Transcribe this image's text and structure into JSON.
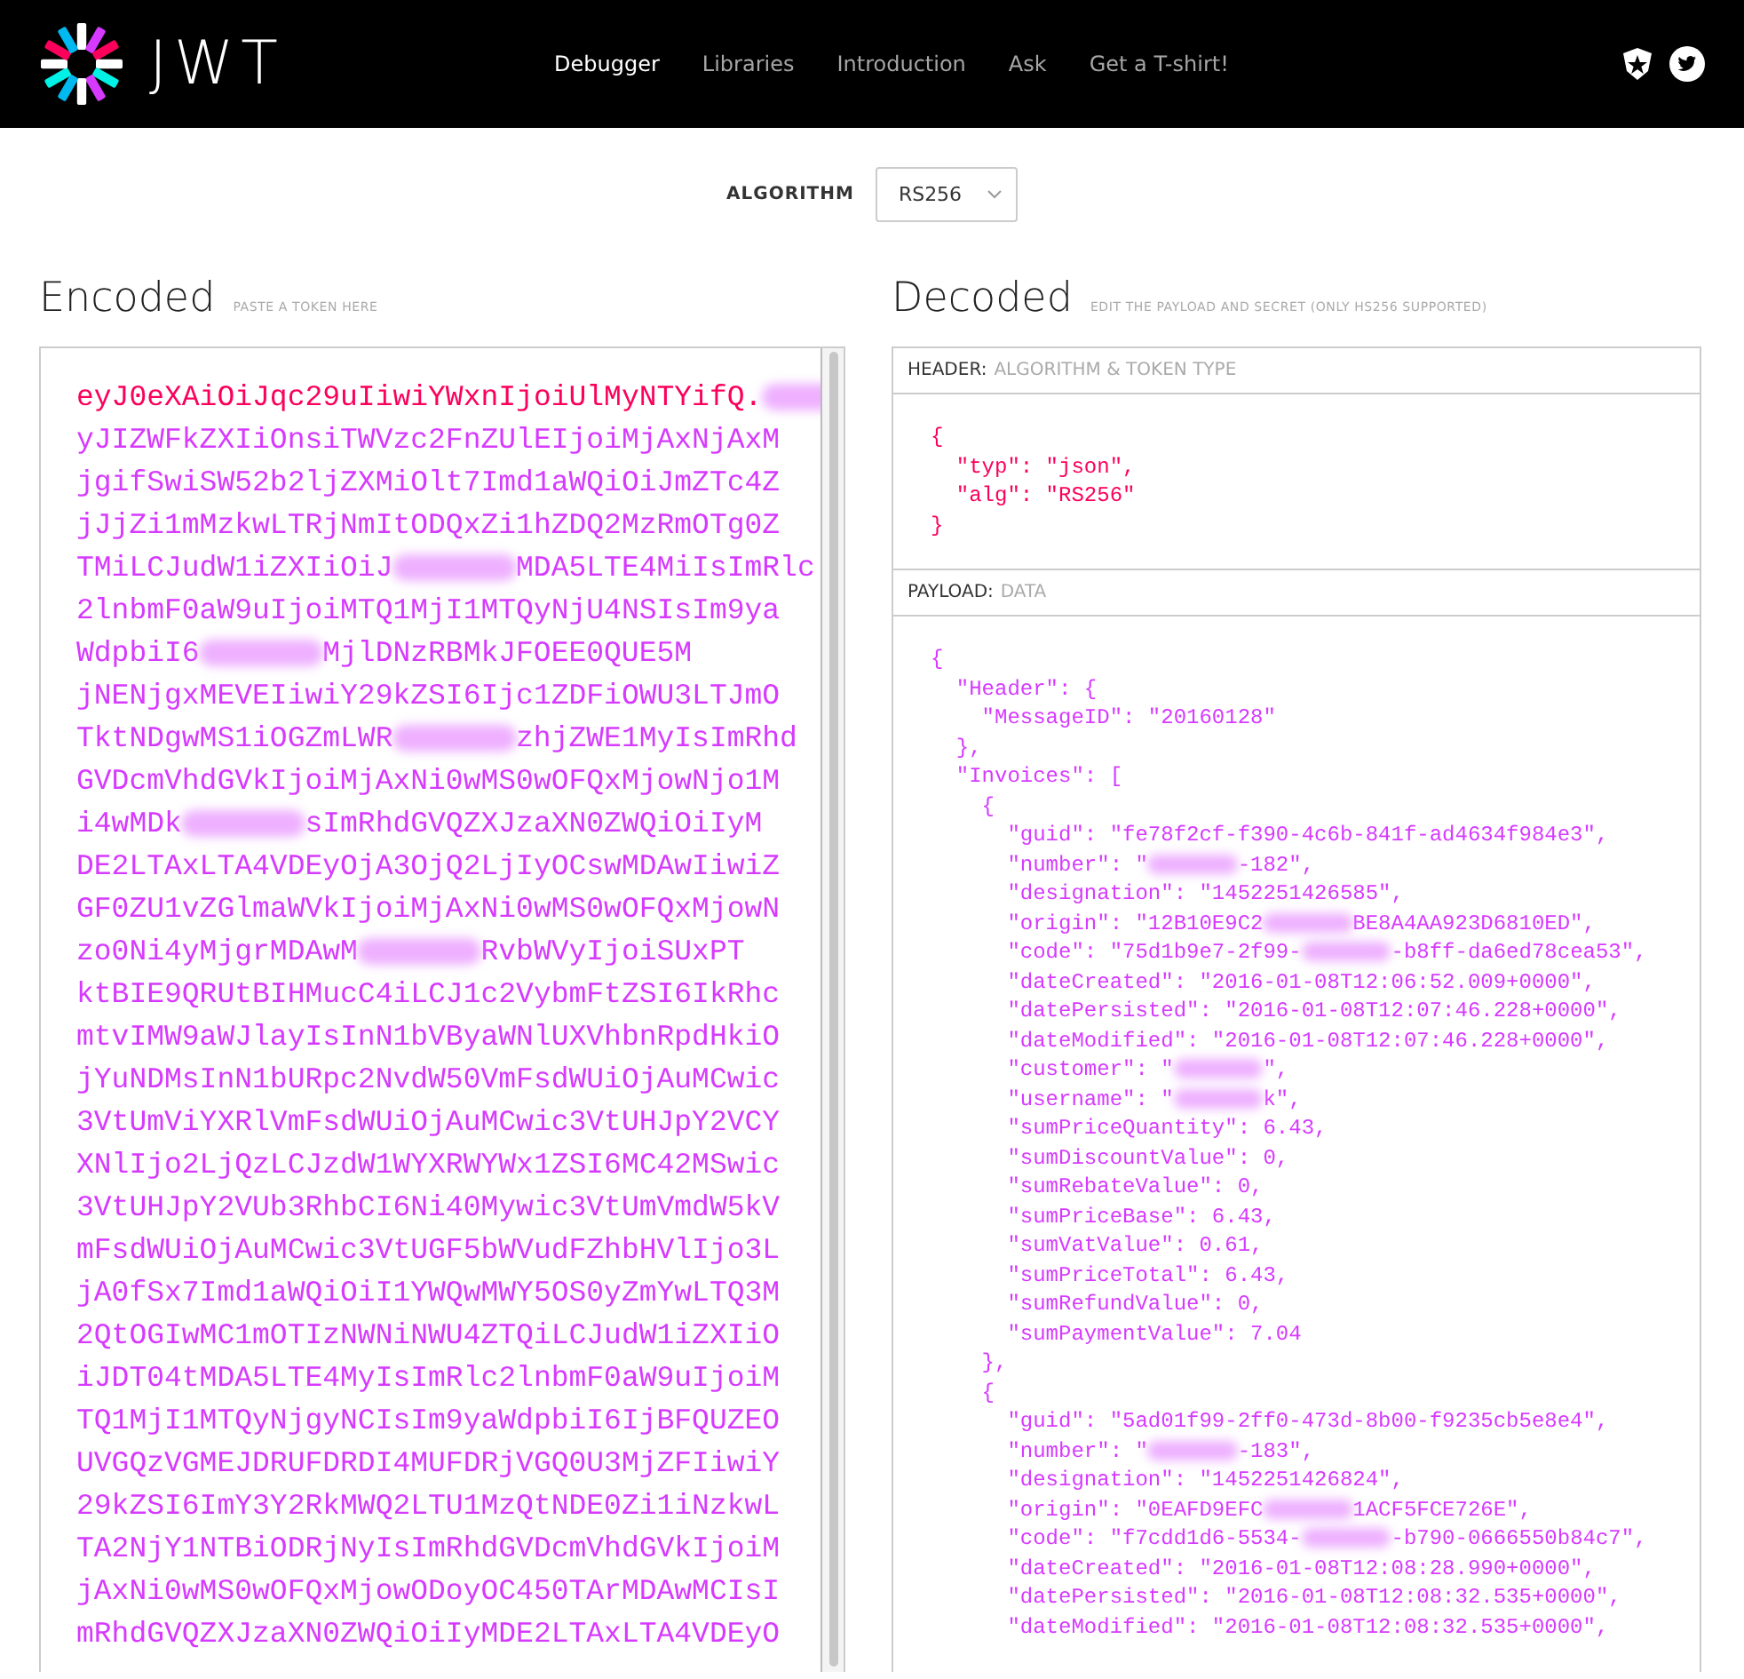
{
  "nav": {
    "brand": "JWT",
    "links": [
      {
        "label": "Debugger",
        "selected": true
      },
      {
        "label": "Libraries",
        "selected": false
      },
      {
        "label": "Introduction",
        "selected": false
      },
      {
        "label": "Ask",
        "selected": false
      },
      {
        "label": "Get a T-shirt!",
        "selected": false
      }
    ]
  },
  "algorithm": {
    "label": "ALGORITHM",
    "value": "RS256"
  },
  "encoded": {
    "title": "Encoded",
    "hint": "PASTE A TOKEN HERE",
    "header_lines": [
      {
        "parts": [
          "eyJ0eXAiOiJqc29uIiwiYWxnIjoiUlMyNTYifQ.",
          {
            "kind": "blur"
          }
        ]
      }
    ],
    "payload_lines": [
      {
        "parts": [
          "yJIZWFkZXIiOnsiTWVzc2FnZUlEIjoiMjAxNjAxM"
        ]
      },
      {
        "parts": [
          "jgifSwiSW52b2ljZXMiOlt7Imd1aWQiOiJmZTc4Z"
        ]
      },
      {
        "parts": [
          "jJjZi1mMzkwLTRjNmItODQxZi1hZDQ2MzRmOTg0Z"
        ]
      },
      {
        "parts": [
          "TMiLCJudW1iZXIiOiJ",
          {
            "kind": "blur"
          },
          "MDA5LTE4MiIsImRlc"
        ]
      },
      {
        "parts": [
          "2lnbmF0aW9uIjoiMTQ1MjI1MTQyNjU4NSIsIm9ya"
        ]
      },
      {
        "parts": [
          "WdpbiI6",
          {
            "kind": "blur"
          },
          "MjlDNzRBMkJFOEE0QUE5M"
        ]
      },
      {
        "parts": [
          "jNENjgxMEVEIiwiY29kZSI6Ijc1ZDFiOWU3LTJmO"
        ]
      },
      {
        "parts": [
          "TktNDgwMS1iOGZmLWR",
          {
            "kind": "blur"
          },
          "zhjZWE1MyIsImRhd"
        ]
      },
      {
        "parts": [
          "GVDcmVhdGVkIjoiMjAxNi0wMS0wOFQxMjowNjo1M"
        ]
      },
      {
        "parts": [
          "i4wMDk",
          {
            "kind": "blur"
          },
          "sImRhdGVQZXJzaXN0ZWQiOiIyM"
        ]
      },
      {
        "parts": [
          "DE2LTAxLTA4VDEyOjA3OjQ2LjIyOCswMDAwIiwiZ"
        ]
      },
      {
        "parts": [
          "GF0ZU1vZGlmaWVkIjoiMjAxNi0wMS0wOFQxMjowN"
        ]
      },
      {
        "parts": [
          "zo0Ni4yMjgrMDAwM",
          {
            "kind": "blur"
          },
          "RvbWVyIjoiSUxPT"
        ]
      },
      {
        "parts": [
          "ktBIE9QRUtBIHMucC4iLCJ1c2VybmFtZSI6IkRhc"
        ]
      },
      {
        "parts": [
          "mtvIMW9aWJlayIsInN1bVByaWNlUXVhbnRpdHkiO"
        ]
      },
      {
        "parts": [
          "jYuNDMsInN1bURpc2NvdW50VmFsdWUiOjAuMCwic"
        ]
      },
      {
        "parts": [
          "3VtUmViYXRlVmFsdWUiOjAuMCwic3VtUHJpY2VCY"
        ]
      },
      {
        "parts": [
          "XNlIjo2LjQzLCJzdW1WYXRWYWx1ZSI6MC42MSwic"
        ]
      },
      {
        "parts": [
          "3VtUHJpY2VUb3RhbCI6Ni40Mywic3VtUmVmdW5kV"
        ]
      },
      {
        "parts": [
          "mFsdWUiOjAuMCwic3VtUGF5bWVudFZhbHVlIjo3L"
        ]
      },
      {
        "parts": [
          "jA0fSx7Imd1aWQiOiI1YWQwMWY5OS0yZmYwLTQ3M"
        ]
      },
      {
        "parts": [
          "2QtOGIwMC1mOTIzNWNiNWU4ZTQiLCJudW1iZXIiO"
        ]
      },
      {
        "parts": [
          "iJDT04tMDA5LTE4MyIsImRlc2lnbmF0aW9uIjoiM"
        ]
      },
      {
        "parts": [
          "TQ1MjI1MTQyNjgyNCIsIm9yaWdpbiI6IjBFQUZEO"
        ]
      },
      {
        "parts": [
          "UVGQzVGMEJDRUFDRDI4MUFDRjVGQ0U3MjZFIiwiY"
        ]
      },
      {
        "parts": [
          "29kZSI6ImY3Y2RkMWQ2LTU1MzQtNDE0Zi1iNzkwL"
        ]
      },
      {
        "parts": [
          "TA2NjY1NTBiODRjNyIsImRhdGVDcmVhdGVkIjoiM"
        ]
      },
      {
        "parts": [
          "jAxNi0wMS0wOFQxMjowODoyOC450TArMDAwMCIsI"
        ]
      },
      {
        "parts": [
          "mRhdGVQZXJzaXN0ZWQiOiIyMDE2LTAxLTA4VDEyO"
        ]
      }
    ]
  },
  "decoded": {
    "title": "Decoded",
    "hint": "EDIT THE PAYLOAD AND SECRET (ONLY HS256 SUPPORTED)",
    "header_panel": {
      "label": "HEADER:",
      "sublabel": "ALGORITHM & TOKEN TYPE",
      "lines": [
        {
          "parts": [
            "{"
          ]
        },
        {
          "parts": [
            "  \"typ\": \"json\","
          ]
        },
        {
          "parts": [
            "  \"alg\": \"RS256\""
          ]
        },
        {
          "parts": [
            "}"
          ]
        }
      ]
    },
    "payload_panel": {
      "label": "PAYLOAD:",
      "sublabel": "DATA",
      "lines": [
        {
          "parts": [
            "{"
          ]
        },
        {
          "parts": [
            "  \"Header\": {"
          ]
        },
        {
          "parts": [
            "    \"MessageID\": \"20160128\""
          ]
        },
        {
          "parts": [
            "  },"
          ]
        },
        {
          "parts": [
            "  \"Invoices\": ["
          ]
        },
        {
          "parts": [
            "    {"
          ]
        },
        {
          "parts": [
            "      \"guid\": \"fe78f2cf-f390-4c6b-841f-ad4634f984e3\","
          ]
        },
        {
          "parts": [
            "      \"number\": \"",
            {
              "kind": "blur"
            },
            "-182\","
          ]
        },
        {
          "parts": [
            "      \"designation\": \"1452251426585\","
          ]
        },
        {
          "parts": [
            "      \"origin\": \"12B10E9C2",
            {
              "kind": "blur"
            },
            "BE8A4AA923D6810ED\","
          ]
        },
        {
          "parts": [
            "      \"code\": \"75d1b9e7-2f99-",
            {
              "kind": "blur"
            },
            "-b8ff-da6ed78cea53\","
          ]
        },
        {
          "parts": [
            "      \"dateCreated\": \"2016-01-08T12:06:52.009+0000\","
          ]
        },
        {
          "parts": [
            "      \"datePersisted\": \"2016-01-08T12:07:46.228+0000\","
          ]
        },
        {
          "parts": [
            "      \"dateModified\": \"2016-01-08T12:07:46.228+0000\","
          ]
        },
        {
          "parts": [
            "      \"customer\": \"",
            {
              "kind": "blur"
            },
            "\","
          ]
        },
        {
          "parts": [
            "      \"username\": \"",
            {
              "kind": "blur"
            },
            "k\","
          ]
        },
        {
          "parts": [
            "      \"sumPriceQuantity\": 6.43,"
          ]
        },
        {
          "parts": [
            "      \"sumDiscountValue\": 0,"
          ]
        },
        {
          "parts": [
            "      \"sumRebateValue\": 0,"
          ]
        },
        {
          "parts": [
            "      \"sumPriceBase\": 6.43,"
          ]
        },
        {
          "parts": [
            "      \"sumVatValue\": 0.61,"
          ]
        },
        {
          "parts": [
            "      \"sumPriceTotal\": 6.43,"
          ]
        },
        {
          "parts": [
            "      \"sumRefundValue\": 0,"
          ]
        },
        {
          "parts": [
            "      \"sumPaymentValue\": 7.04"
          ]
        },
        {
          "parts": [
            "    },"
          ]
        },
        {
          "parts": [
            "    {"
          ]
        },
        {
          "parts": [
            "      \"guid\": \"5ad01f99-2ff0-473d-8b00-f9235cb5e8e4\","
          ]
        },
        {
          "parts": [
            "      \"number\": \"",
            {
              "kind": "blur"
            },
            "-183\","
          ]
        },
        {
          "parts": [
            "      \"designation\": \"1452251426824\","
          ]
        },
        {
          "parts": [
            "      \"origin\": \"0EAFD9EFC",
            {
              "kind": "blur"
            },
            "1ACF5FCE726E\","
          ]
        },
        {
          "parts": [
            "      \"code\": \"f7cdd1d6-5534-",
            {
              "kind": "blur"
            },
            "-b790-0666550b84c7\","
          ]
        },
        {
          "parts": [
            "      \"dateCreated\": \"2016-01-08T12:08:28.990+0000\","
          ]
        },
        {
          "parts": [
            "      \"datePersisted\": \"2016-01-08T12:08:32.535+0000\","
          ]
        },
        {
          "parts": [
            "      \"dateModified\": \"2016-01-08T12:08:32.535+0000\","
          ]
        }
      ]
    }
  }
}
